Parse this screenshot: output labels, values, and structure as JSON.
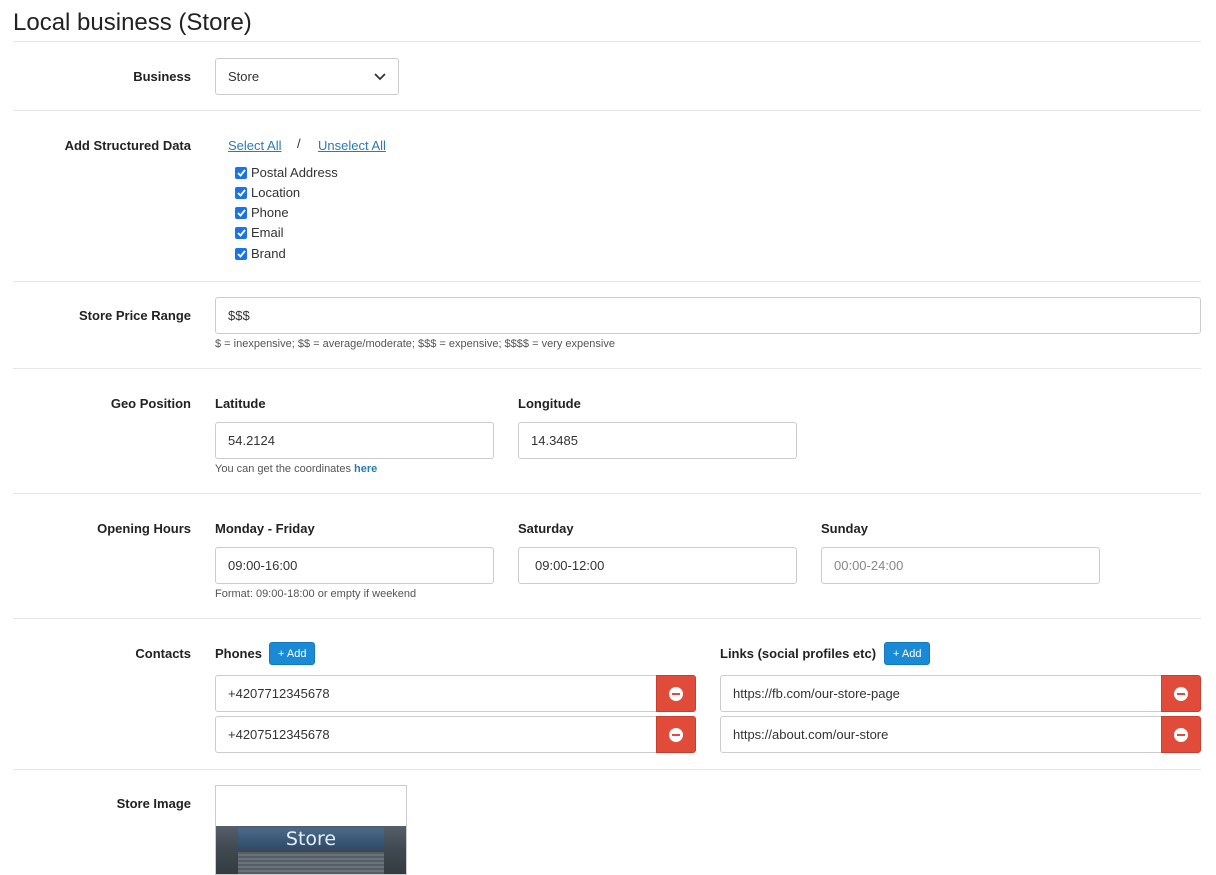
{
  "page": {
    "title": "Local business (Store)"
  },
  "business": {
    "label": "Business",
    "selected": "Store"
  },
  "structured_data": {
    "label": "Add Structured Data",
    "select_all": "Select All",
    "separator": "/",
    "unselect_all": "Unselect All",
    "items": [
      {
        "label": "Postal Address",
        "checked": true
      },
      {
        "label": "Location",
        "checked": true
      },
      {
        "label": "Phone",
        "checked": true
      },
      {
        "label": "Email",
        "checked": true
      },
      {
        "label": "Brand",
        "checked": true
      }
    ]
  },
  "price_range": {
    "label": "Store Price Range",
    "value": "$$$",
    "help": "$ = inexpensive; $$ = average/moderate; $$$ = expensive; $$$$ = very expensive"
  },
  "geo": {
    "label": "Geo Position",
    "latitude_label": "Latitude",
    "latitude": "54.2124",
    "longitude_label": "Longitude",
    "longitude": "14.3485",
    "help_prefix": "You can get the coordinates ",
    "help_link": "here"
  },
  "hours": {
    "label": "Opening Hours",
    "weekdays_label": "Monday - Friday",
    "weekdays": "09:00-16:00",
    "saturday_label": "Saturday",
    "saturday": "09:00-12:00",
    "sunday_label": "Sunday",
    "sunday_placeholder": "00:00-24:00",
    "help": "Format: 09:00-18:00 or empty if weekend"
  },
  "contacts": {
    "label": "Contacts",
    "phones_label": "Phones",
    "add_label": "+ Add",
    "phones": [
      "+4207712345678",
      "+4207512345678"
    ],
    "links_label": "Links (social profiles etc)",
    "links": [
      "https://fb.com/our-store-page",
      "https://about.com/our-store"
    ]
  },
  "image": {
    "label": "Store Image",
    "sign_text": "Store"
  },
  "colors": {
    "accent": "#1a8ad6",
    "danger": "#e04b3a",
    "checkbox": "#1a73e8",
    "link": "#2a7ab8"
  }
}
